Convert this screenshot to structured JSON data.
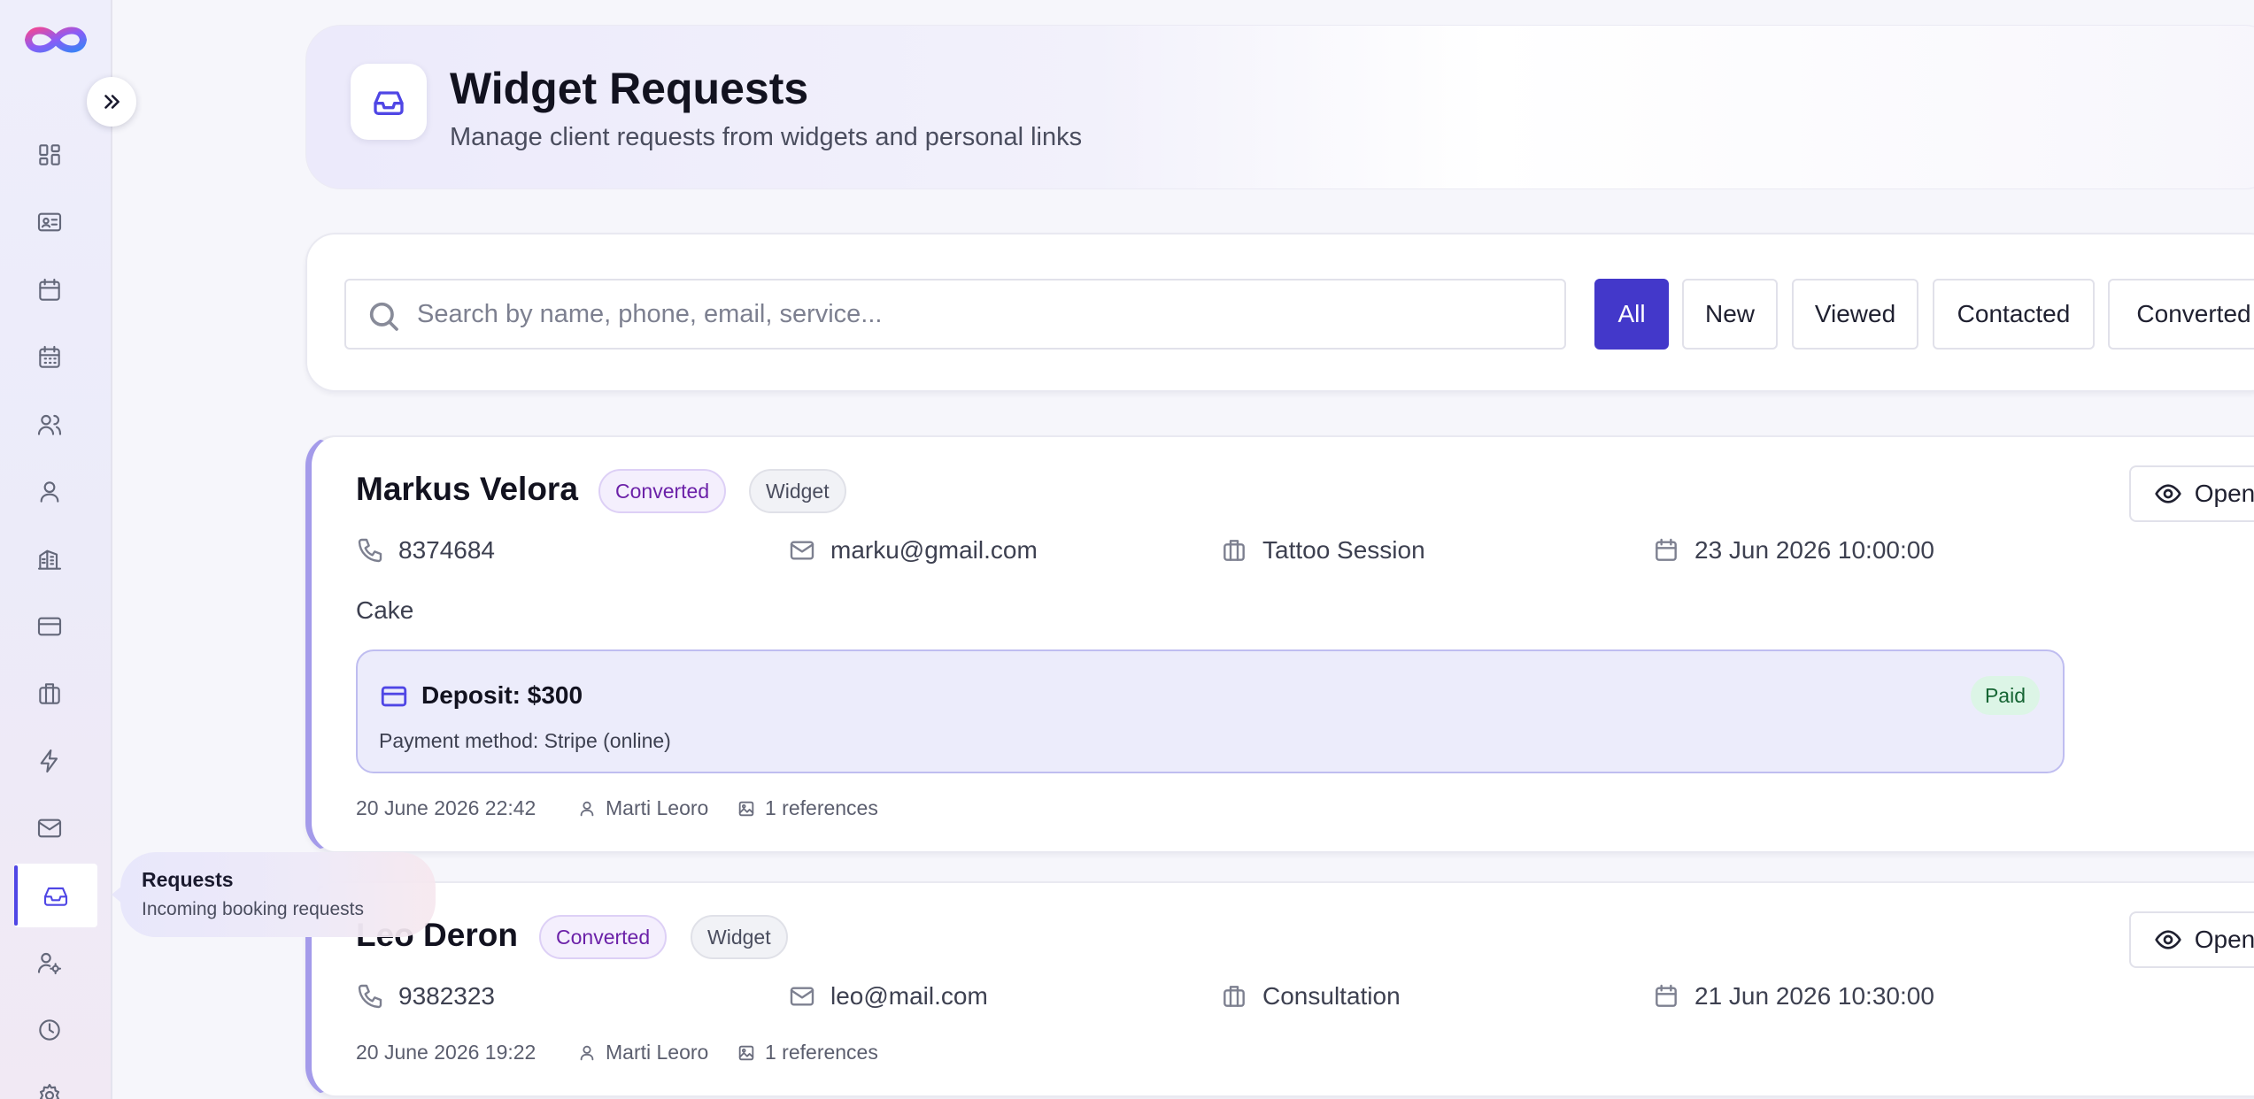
{
  "header": {
    "title": "Widget Requests",
    "subtitle": "Manage client requests from widgets and personal links",
    "icon": "inbox-icon"
  },
  "tooltip": {
    "title": "Requests",
    "subtitle": "Incoming booking requests"
  },
  "search": {
    "placeholder": "Search by name, phone, email, service...",
    "value": ""
  },
  "filters": [
    {
      "label": "All",
      "active": true
    },
    {
      "label": "New",
      "active": false
    },
    {
      "label": "Viewed",
      "active": false
    },
    {
      "label": "Contacted",
      "active": false
    },
    {
      "label": "Converted",
      "active": false
    }
  ],
  "requests": [
    {
      "name": "Markus Velora",
      "status": "Converted",
      "source": "Widget",
      "phone": "8374684",
      "email": "marku@gmail.com",
      "service": "Tattoo Session",
      "datetime": "23 Jun 2026 10:00:00",
      "note": "Cake",
      "deposit_title": "Deposit: $300",
      "deposit_method": "Payment method: Stripe (online)",
      "deposit_status": "Paid",
      "created": "20 June 2026 22:42",
      "artist": "Marti Leoro",
      "references": "1 references",
      "open_label": "Open"
    },
    {
      "name": "Leo Deron",
      "status": "Converted",
      "source": "Widget",
      "phone": "9382323",
      "email": "leo@mail.com",
      "service": "Consultation",
      "datetime": "21 Jun 2026 10:30:00",
      "created": "20 June 2026 19:22",
      "artist": "Marti Leoro",
      "references": "1 references",
      "open_label": "Open"
    }
  ],
  "colors": {
    "accent": "#4f46e5",
    "active_filter": "#4338ca",
    "converted_text": "#6b21a8",
    "paid_bg": "#dcf5e6",
    "paid_text": "#166534"
  }
}
